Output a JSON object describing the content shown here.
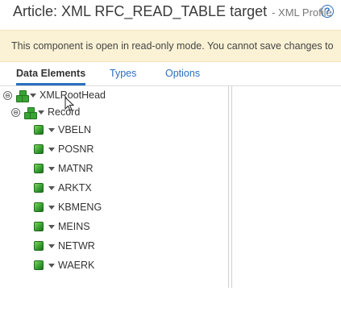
{
  "header": {
    "title": "Article: XML RFC_READ_TABLE target",
    "subtitle": "- XML Profile",
    "help_glyph": "?"
  },
  "banner": {
    "message": "This component is open in read-only mode. You cannot save changes to"
  },
  "tabs": [
    {
      "label": "Data Elements",
      "active": true
    },
    {
      "label": "Types",
      "active": false
    },
    {
      "label": "Options",
      "active": false
    }
  ],
  "tree": {
    "root": {
      "label": "XMLRootHead",
      "toggle": "⊖",
      "icon": "element-cluster-icon"
    },
    "record": {
      "label": "Record",
      "toggle": "⊖",
      "icon": "element-cluster-icon"
    },
    "fields": [
      {
        "label": "VBELN",
        "icon": "cube-icon"
      },
      {
        "label": "POSNR",
        "icon": "cube-icon"
      },
      {
        "label": "MATNR",
        "icon": "cube-icon"
      },
      {
        "label": "ARKTX",
        "icon": "cube-icon"
      },
      {
        "label": "KBMENG",
        "icon": "cube-icon"
      },
      {
        "label": "MEINS",
        "icon": "cube-icon"
      },
      {
        "label": "NETWR",
        "icon": "cube-icon"
      },
      {
        "label": "WAERK",
        "icon": "cube-icon"
      }
    ]
  },
  "colors": {
    "accent": "#2a6fc0",
    "banner_bg": "#fbf2d5",
    "icon_green": "#38a135"
  }
}
